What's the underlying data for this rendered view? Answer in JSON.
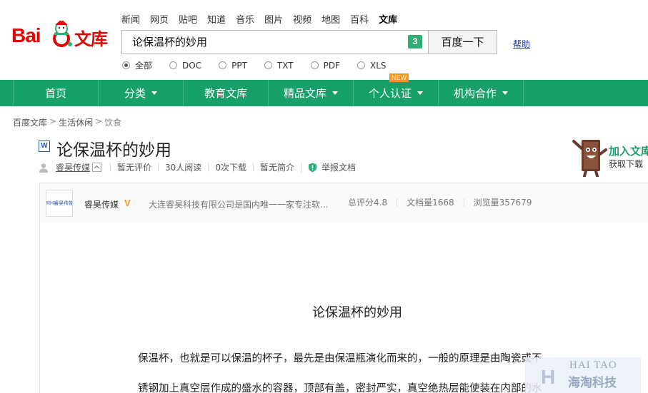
{
  "logo": {
    "text_en": "Bai",
    "text_cn": "文库"
  },
  "topnav": {
    "items": [
      {
        "label": "新闻",
        "active": false
      },
      {
        "label": "网页",
        "active": false
      },
      {
        "label": "贴吧",
        "active": false
      },
      {
        "label": "知道",
        "active": false
      },
      {
        "label": "音乐",
        "active": false
      },
      {
        "label": "图片",
        "active": false
      },
      {
        "label": "视频",
        "active": false
      },
      {
        "label": "地图",
        "active": false
      },
      {
        "label": "百科",
        "active": false
      },
      {
        "label": "文库",
        "active": true
      }
    ]
  },
  "search": {
    "value": "论保温杯的妙用",
    "badge": "3",
    "button_label": "百度一下",
    "help_label": "帮助"
  },
  "filters": [
    {
      "label": "全部",
      "checked": true
    },
    {
      "label": "DOC",
      "checked": false
    },
    {
      "label": "PPT",
      "checked": false
    },
    {
      "label": "TXT",
      "checked": false
    },
    {
      "label": "PDF",
      "checked": false
    },
    {
      "label": "XLS",
      "checked": false
    }
  ],
  "mainnav": {
    "items": [
      {
        "label": "首页",
        "dropdown": false
      },
      {
        "label": "分类",
        "dropdown": true
      },
      {
        "label": "教育文库",
        "dropdown": false
      },
      {
        "label": "精品文库",
        "dropdown": true
      },
      {
        "label": "个人认证",
        "dropdown": true
      },
      {
        "label": "机构合作",
        "dropdown": true
      }
    ],
    "new_badge": "NEW"
  },
  "breadcrumb": [
    "百度文库",
    "生活休闲",
    "饮食"
  ],
  "doc": {
    "type_icon": "W",
    "title": "论保温杯的妙用",
    "author": "睿昊传媒",
    "rating": "暂无评价",
    "reads": "30人阅读",
    "downloads": "0次下载",
    "summary": "暂无简介",
    "report": "举报文档"
  },
  "promo": {
    "title": "加入文库",
    "subtitle": "获取下载"
  },
  "author_card": {
    "logo_text": "RH睿昊传媒",
    "name": "睿昊传媒",
    "verified_mark": "V",
    "description": "大连睿昊科技有限公司是国内唯一一家专注软...",
    "stats": [
      "总评分4.8",
      "文档量1668",
      "浏览量357679"
    ]
  },
  "content": {
    "heading": "论保温杯的妙用",
    "lines": [
      "保温杯，也就是可以保温的杯子，最先是由保温瓶演化而来的，一般的原理是由陶瓷或不",
      "锈钢加上真空层作成的盛水的容器，顶部有盖，密封严实，真空绝热层能使装在内部的水"
    ]
  },
  "watermark": {
    "letter": "H",
    "en": "HAI TAO",
    "cn": "海淘科技"
  },
  "colors": {
    "brand_green": "#18a06a",
    "brand_red": "#e10602",
    "accent_orange": "#f7931e",
    "link_blue": "#1a39b8"
  }
}
